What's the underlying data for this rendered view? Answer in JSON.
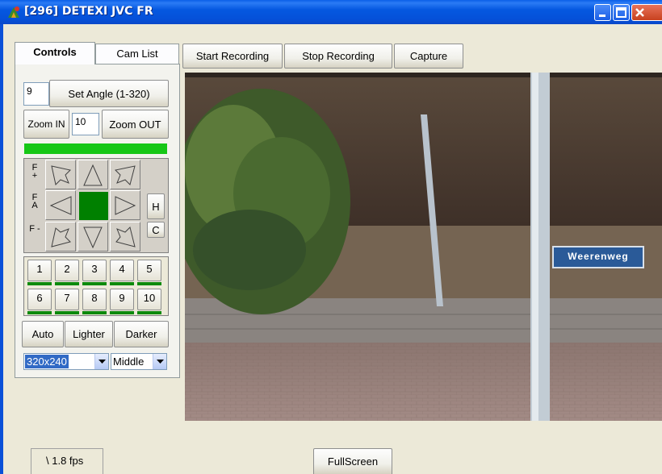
{
  "window": {
    "title": "[296] DETEXI JVC FR"
  },
  "tabs": [
    {
      "label": "Controls"
    },
    {
      "label": "Cam List"
    }
  ],
  "toolbar": {
    "start_recording": "Start Recording",
    "stop_recording": "Stop Recording",
    "capture": "Capture"
  },
  "controls": {
    "angle_value": "9",
    "set_angle_label": "Set Angle (1-320)",
    "zoom_in_label": "Zoom IN",
    "zoom_value": "10",
    "zoom_out_label": "Zoom OUT",
    "focus_plus_label": "F +",
    "focus_auto_label": "F A",
    "focus_minus_label": "F -",
    "h_label": "H",
    "c_label": "C",
    "presets": [
      "1",
      "2",
      "3",
      "4",
      "5",
      "6",
      "7",
      "8",
      "9",
      "10"
    ],
    "auto_label": "Auto",
    "lighter_label": "Lighter",
    "darker_label": "Darker",
    "resolution_value": "320x240",
    "quality_value": "Middle"
  },
  "video": {
    "sign_text": "Weerenweg"
  },
  "status": {
    "fps_text": "\\ 1.8 fps",
    "fullscreen_label": "FullScreen"
  },
  "colors": {
    "titlebar": "#0558e0",
    "green_indicator": "#16c716",
    "ptz_center": "#008000",
    "preset_underline": "#0c8a0c"
  }
}
